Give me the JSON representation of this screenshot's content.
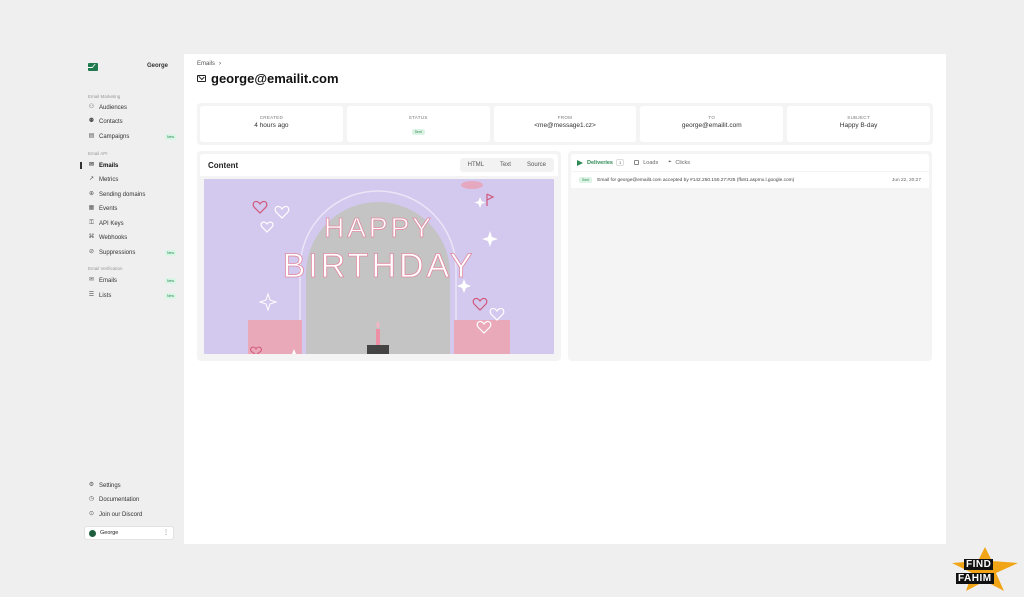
{
  "sidebar": {
    "brand_name": "George",
    "section_email_marketing": "Email Marketing",
    "section_email_api": "Email API",
    "section_email_verification": "Email Verification",
    "items": [
      {
        "label": "Audiences",
        "icon": "audience-icon"
      },
      {
        "label": "Contacts",
        "icon": "contacts-icon"
      },
      {
        "label": "Campaigns",
        "icon": "campaigns-icon",
        "badge": "New"
      },
      {
        "label": "Emails",
        "icon": "mail-icon",
        "active": true
      },
      {
        "label": "Metrics",
        "icon": "chart-icon"
      },
      {
        "label": "Sending domains",
        "icon": "globe-icon"
      },
      {
        "label": "Events",
        "icon": "events-icon"
      },
      {
        "label": "API Keys",
        "icon": "key-icon"
      },
      {
        "label": "Webhooks",
        "icon": "webhook-icon"
      },
      {
        "label": "Suppressions",
        "icon": "suppression-icon",
        "badge": "New"
      },
      {
        "label": "Emails",
        "icon": "mail-icon",
        "badge": "New"
      },
      {
        "label": "Lists",
        "icon": "list-icon",
        "badge": "New"
      }
    ],
    "footer_items": [
      {
        "label": "Settings",
        "icon": "gear-icon"
      },
      {
        "label": "Documentation",
        "icon": "docs-icon"
      },
      {
        "label": "Join our Discord",
        "icon": "discord-icon"
      }
    ],
    "user_name": "George"
  },
  "main": {
    "breadcrumb": "Emails",
    "title": "george@emailit.com",
    "info": [
      {
        "label": "CREATED",
        "value": "4 hours ago"
      },
      {
        "label": "STATUS",
        "value": "Sent"
      },
      {
        "label": "FROM",
        "value": "<me@message1.cz>"
      },
      {
        "label": "TO",
        "value": "george@emailit.com"
      },
      {
        "label": "SUBJECT",
        "value": "Happy B-day"
      }
    ],
    "content_title": "Content",
    "content_tabs": [
      "HTML",
      "Text",
      "Source"
    ],
    "preview_line1": "HAPPY",
    "preview_line2": "BIRTHDAY",
    "event_tabs": [
      {
        "label": "Deliveries",
        "count": "1"
      },
      {
        "label": "Loads"
      },
      {
        "label": "Clicks"
      }
    ],
    "event": {
      "status": "Sent",
      "message": "Email for george@emailit.com accepted by #142.250.150.27:#25 (ffx81.aspmx.l.google.com)",
      "time": "Jun 22, 20:27"
    }
  },
  "watermark": {
    "line1": "FIND",
    "line2": "FAHIM"
  },
  "colors": {
    "accent": "#2e8a55",
    "brand": "#1f7a4d",
    "preview_bg": "#d3c8ee"
  }
}
